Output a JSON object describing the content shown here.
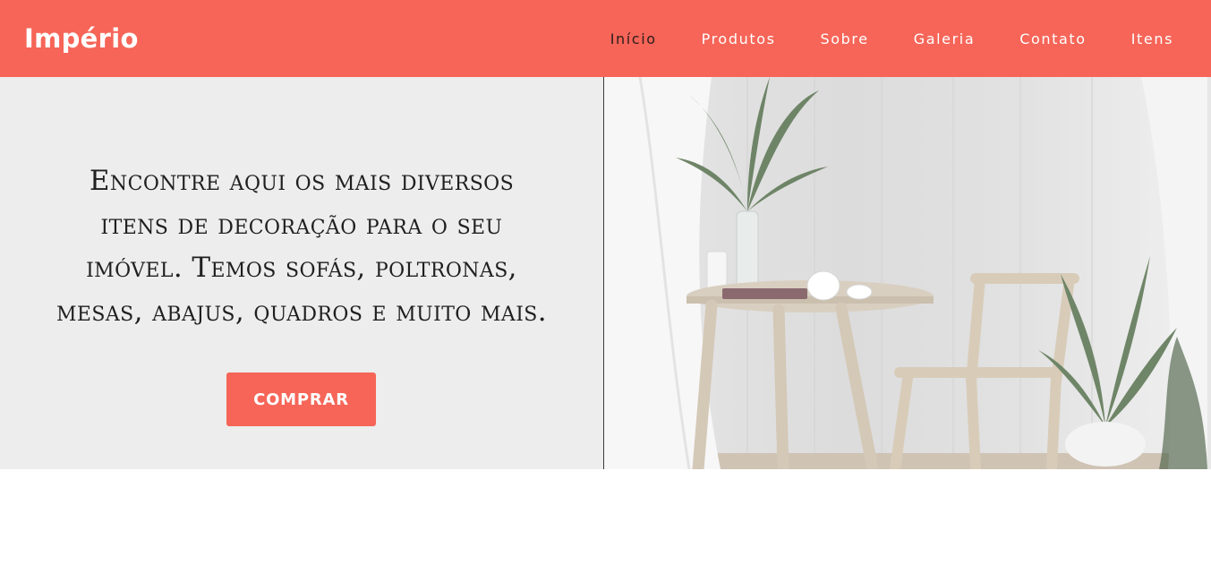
{
  "brand": {
    "name": "Império"
  },
  "nav": {
    "items": [
      {
        "label": "Início",
        "active": true
      },
      {
        "label": "Produtos",
        "active": false
      },
      {
        "label": "Sobre",
        "active": false
      },
      {
        "label": "Galeria",
        "active": false
      },
      {
        "label": "Contato",
        "active": false
      },
      {
        "label": "Itens",
        "active": false
      }
    ]
  },
  "hero": {
    "lines": [
      "Encontre aqui os mais diversos",
      "itens de decoração para o seu",
      "imóvel. Temos sofás, poltronas,",
      "mesas, abajus, quadros e muito mais."
    ],
    "button_label": "COMPRAR",
    "image": "interior-photo: round wooden table, wooden chair, plants, white curtains"
  },
  "colors": {
    "accent": "#f66558",
    "hero_bg": "#ededed",
    "active_nav": "#2a1d1b"
  }
}
